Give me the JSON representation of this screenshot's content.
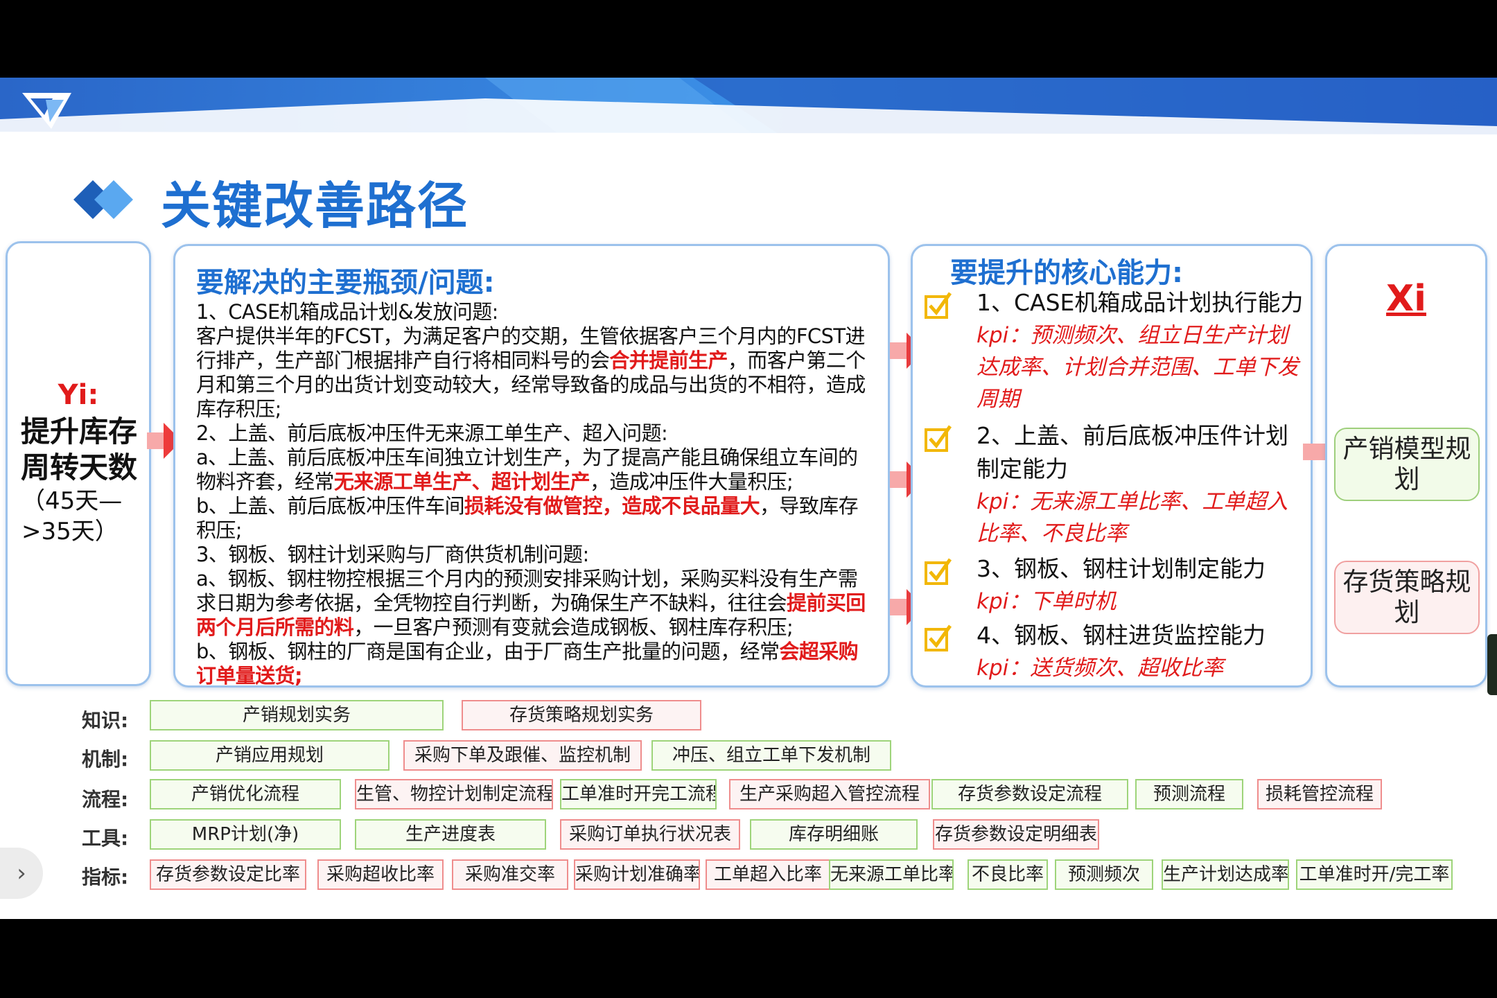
{
  "title": "关键改善路径",
  "yi": {
    "label": "Yi:",
    "main": "提升库存周转天数",
    "range": "（45天—>35天）"
  },
  "problems": {
    "title": "要解决的主要瓶颈/问题:",
    "p1_head": "1、CASE机箱成品计划&发放问题:",
    "p1_a": "        客户提供半年的FCST，为满足客户的交期，生管依据客户三个月内的FCST进行排产，生产部门根据排产自行将相同料号的会",
    "p1_hl": "合并提前生产",
    "p1_b": "，而客户第二个月和第三个月的出货计划变动较大，经常导致备的成品与出货的不相符，造成库存积压;",
    "p2_head": "2、上盖、前后底板冲压件无来源工单生产、超入问题:",
    "p2_a1": "   a、上盖、前后底板冲压车间独立计划生产，为了提高产能且确保组立车间的物料齐套，经常",
    "p2_hl1": "无来源工单生产、超计划生产",
    "p2_a2": "，造成冲压件大量积压;",
    "p2_b1": "    b、上盖、前后底板冲压件车间",
    "p2_hl2": "损耗没有做管控，造成不良品量大",
    "p2_b2": "，导致库存积压;",
    "p3_head": "3、钢板、钢柱计划采购与厂商供货机制问题:",
    "p3_a1": "     a、钢板、钢柱物控根据三个月内的预测安排采购计划，采购买料没有生产需求日期为参考依据，全凭物控自行判断，为确保生产不缺料，往往会",
    "p3_hl1": "提前买回两个月后所需的料",
    "p3_a2": "，一旦客户预测有变就会造成钢板、钢柱库存积压;",
    "p3_b1": "     b、钢板、钢柱的厂商是国有企业，由于厂商生产批量的问题，经常",
    "p3_hl2": "会超采购订单量送货;"
  },
  "capabilities": {
    "title": "要提升的核心能力:",
    "items": [
      {
        "main": "1、CASE机箱成品计划执行能力",
        "kpi": "kpi：预测频次、组立日生产计划达成率、计划合并范围、工单下发周期"
      },
      {
        "main": "2、上盖、前后底板冲压件计划制定能力",
        "kpi": "kpi：无来源工单比率、工单超入比率、不良比率"
      },
      {
        "main": "3、钢板、钢柱计划制定能力",
        "kpi": "kpi：下单时机"
      },
      {
        "main": "4、钢板、钢柱进货监控能力",
        "kpi": "kpi：送货频次、超收比率"
      }
    ]
  },
  "xi": {
    "label": "Xi",
    "tag1": "产销模型规划",
    "tag2": "存货策略规划"
  },
  "rows": [
    {
      "label": "知识:",
      "chips": [
        "产销规划实务",
        "存货策略规划实务"
      ]
    },
    {
      "label": "机制:",
      "chips": [
        "产销应用规划",
        "采购下单及跟催、监控机制",
        "冲压、组立工单下发机制"
      ]
    },
    {
      "label": "流程:",
      "chips": [
        "产销优化流程",
        "生管、物控计划制定流程",
        "工单准时开完工流程",
        "生产采购超入管控流程",
        "存货参数设定流程",
        "预测流程",
        "损耗管控流程"
      ]
    },
    {
      "label": "工具:",
      "chips": [
        "MRP计划(净)",
        "生产进度表",
        "采购订单执行状况表",
        "库存明细账",
        "存货参数设定明细表"
      ]
    },
    {
      "label": "指标:",
      "chips": [
        "存货参数设定比率",
        "采购超收比率",
        "采购准交率",
        "采购计划准确率",
        "工单超入比率",
        "无来源工单比率",
        "不良比率",
        "预测频次",
        "生产计划达成率",
        "工单准时开/完工率"
      ]
    }
  ],
  "nav": {
    "next": "›"
  },
  "colors": {
    "accent": "#1e6fd0",
    "highlight": "#e11b1b",
    "green_border": "#9ed47a",
    "red_border": "#ef8d8d"
  }
}
